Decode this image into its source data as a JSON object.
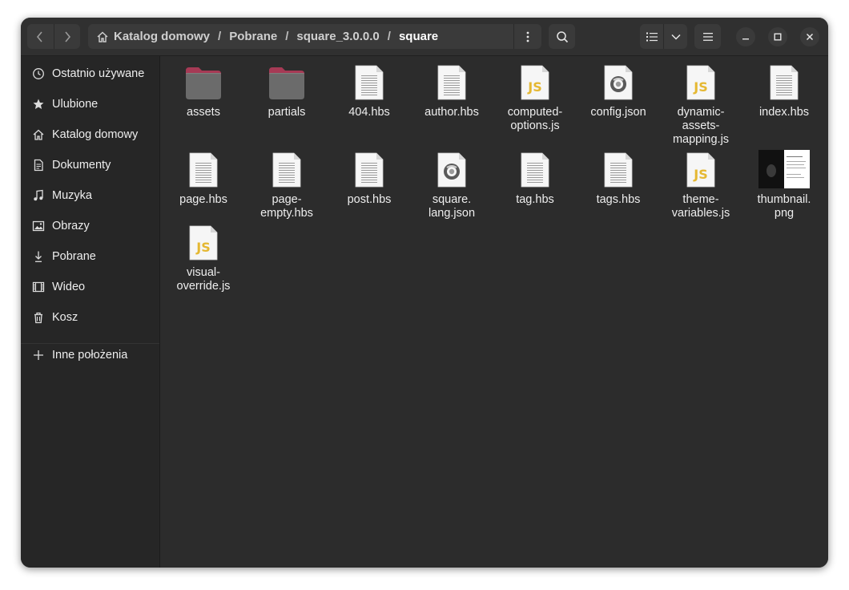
{
  "window": {
    "pathbar": {
      "crumbs": [
        "Katalog domowy",
        "Pobrane",
        "square_3.0.0.0",
        "square"
      ],
      "separator": "/"
    }
  },
  "sidebar": {
    "items": [
      {
        "label": "Ostatnio używane",
        "icon": "clock-icon"
      },
      {
        "label": "Ulubione",
        "icon": "star-icon"
      },
      {
        "label": "Katalog domowy",
        "icon": "home-icon"
      },
      {
        "label": "Dokumenty",
        "icon": "document-icon"
      },
      {
        "label": "Muzyka",
        "icon": "music-icon"
      },
      {
        "label": "Obrazy",
        "icon": "image-icon"
      },
      {
        "label": "Pobrane",
        "icon": "download-icon"
      },
      {
        "label": "Wideo",
        "icon": "video-icon"
      },
      {
        "label": "Kosz",
        "icon": "trash-icon"
      }
    ],
    "other_locations": {
      "label": "Inne położenia",
      "icon": "plus-icon"
    }
  },
  "files": [
    {
      "name": "assets",
      "type": "folder"
    },
    {
      "name": "partials",
      "type": "folder"
    },
    {
      "name": "404.hbs",
      "type": "text"
    },
    {
      "name": "author.hbs",
      "type": "text"
    },
    {
      "name": "computed-\noptions.js",
      "type": "js"
    },
    {
      "name": "config.json",
      "type": "json"
    },
    {
      "name": "dynamic-\nassets-\nmapping.js",
      "type": "js"
    },
    {
      "name": "index.hbs",
      "type": "text"
    },
    {
      "name": "page.hbs",
      "type": "text"
    },
    {
      "name": "page-\nempty.hbs",
      "type": "text"
    },
    {
      "name": "post.hbs",
      "type": "text"
    },
    {
      "name": "square.\nlang.json",
      "type": "json"
    },
    {
      "name": "tag.hbs",
      "type": "text"
    },
    {
      "name": "tags.hbs",
      "type": "text"
    },
    {
      "name": "theme-\nvariables.js",
      "type": "js"
    },
    {
      "name": "thumbnail.\npng",
      "type": "image"
    },
    {
      "name": "visual-\noverride.js",
      "type": "js"
    }
  ],
  "js_badge": "JS",
  "colors": {
    "window_bg": "#2c2c2c",
    "sidebar_bg": "#262626",
    "folder_tab": "#a63a55",
    "folder_body": "#6b6b6b",
    "js_yellow": "#e5b832"
  }
}
